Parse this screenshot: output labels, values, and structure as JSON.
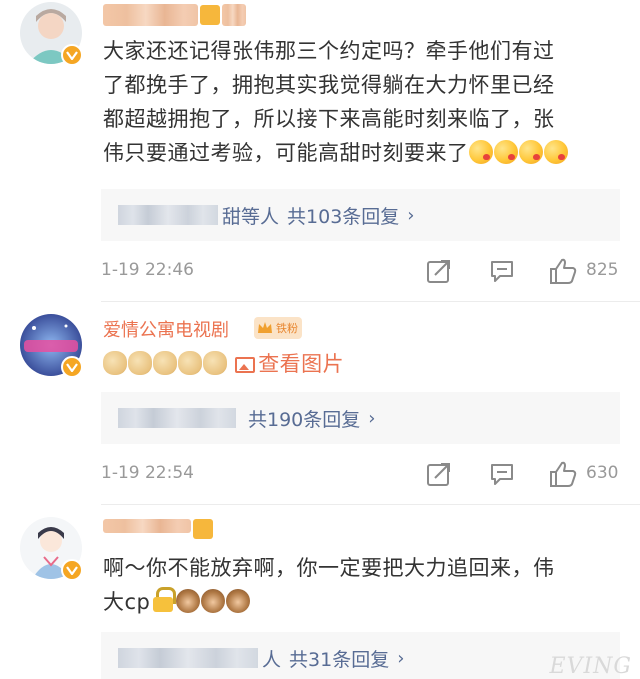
{
  "comments": [
    {
      "user_name": "",
      "text_line1": "大家还还记得张伟那三个约定吗？牵手他们有过",
      "text_line2": "了都挽手了，拥抱其实我觉得躺在大力怀里已经",
      "text_line3": "都超越拥抱了，所以接下来高能时刻来临了，张",
      "text_line4": "伟只要通过考验，可能高甜时刻要来了",
      "emojis": [
        "kiss-face-icon",
        "kiss-face-icon",
        "kiss-face-icon",
        "kiss-face-icon"
      ],
      "reply_suffix": "甜等人",
      "reply_count": "共103条回复",
      "reply_arrow": "›",
      "time": "1-19 22:46",
      "like_count": "825"
    },
    {
      "user_name": "爱情公寓电视剧",
      "fan_badge": "铁粉",
      "emojis": [
        "doge-icon",
        "doge-icon",
        "doge-icon",
        "doge-icon",
        "doge-icon"
      ],
      "picture_link": "查看图片",
      "reply_count": "共190条回复",
      "reply_arrow": "›",
      "time": "1-19 22:54",
      "like_count": "630"
    },
    {
      "user_name": "",
      "text_line1": "啊～你不能放弃啊，你一定要把大力追回来，伟",
      "text_line2": "大cp",
      "emojis": [
        "lock-icon",
        "monkey-icon",
        "monkey-icon",
        "monkey-icon"
      ],
      "reply_suffix": "人",
      "reply_count": "共31条回复",
      "reply_arrow": "›"
    }
  ],
  "watermark": "EVING",
  "colors": {
    "name": "#eb7350",
    "link": "#586c94",
    "meta": "#999999",
    "reply_bg": "#f7f7f7",
    "verified": "#f5a623"
  }
}
